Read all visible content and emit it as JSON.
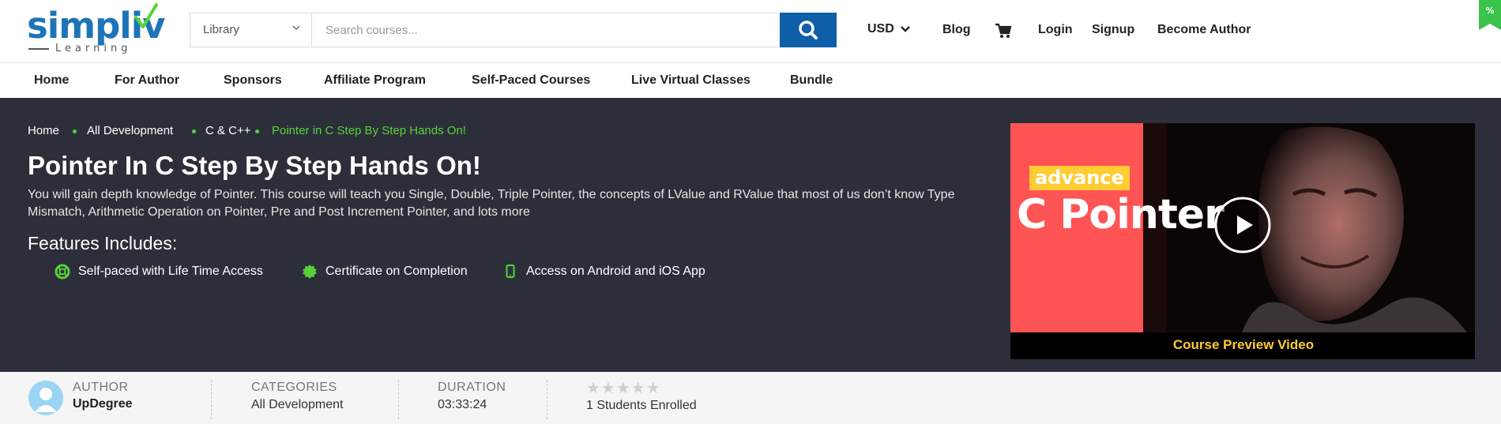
{
  "header": {
    "logo_text": "simpliv",
    "logo_subtext": "Learning",
    "category_select": "Library",
    "search_placeholder": "Search courses...",
    "currency": "USD",
    "links": [
      "Blog",
      "Login",
      "Signup",
      "Become Author"
    ],
    "icons": {
      "search": "search-icon",
      "cart": "cart-icon",
      "currency_caret": "chevron-down-icon",
      "select_caret": "chevron-down-icon",
      "corner_badge": "discount-tag-icon"
    },
    "colors": {
      "brand_blue": "#1d75b7",
      "search_button": "#0f5ea8",
      "logo_check": "#56d23a"
    }
  },
  "subnav": {
    "items": [
      "Home",
      "For Author",
      "Sponsors",
      "Affiliate Program",
      "Self-Paced Courses",
      "Live Virtual Classes",
      "Bundle"
    ]
  },
  "hero": {
    "breadcrumb": [
      "Home",
      "All Development",
      "C & C++",
      "Pointer in C Step By Step Hands On!"
    ],
    "title": "Pointer In C Step By Step Hands On!",
    "description": "You will gain depth knowledge of Pointer. This course will teach you Single, Double, Triple Pointer, the concepts of LValue and RValue that most of us don’t know Type Mismatch, Arithmetic Operation on Pointer, Pre and Post Increment Pointer, and lots more",
    "features_title": "Features Includes:",
    "features": [
      {
        "label": "Self-paced with Life Time Access",
        "icon": "lifebuoy-icon"
      },
      {
        "label": "Certificate on Completion",
        "icon": "certificate-badge-icon"
      },
      {
        "label": "Access on Android and iOS App",
        "icon": "mobile-icon"
      }
    ],
    "video": {
      "tag": "advance",
      "headline": "C Pointer",
      "caption": "Course Preview Video",
      "play_icon": "play-icon"
    },
    "colors": {
      "background": "#2c2f3a",
      "accent_green": "#56d23a",
      "video_red": "#ff5454",
      "video_yellow": "#ffcc33"
    }
  },
  "info": {
    "author_label": "AUTHOR",
    "author": "UpDegree",
    "categories_label": "CATEGORIES",
    "category": "All Development",
    "duration_label": "DURATION",
    "duration": "03:33:24",
    "rating_stars": "★★★★★",
    "enrolled": "1 Students Enrolled"
  }
}
